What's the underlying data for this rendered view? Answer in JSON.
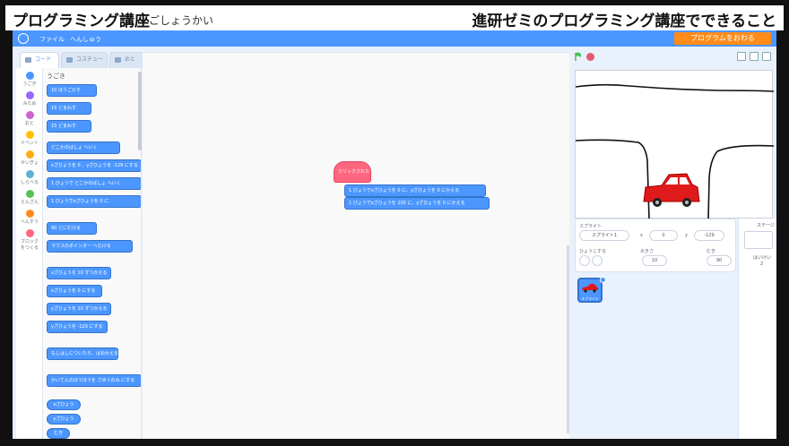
{
  "banner": {
    "left_title": "プログラミング講座",
    "left_subtitle": "ごしょうかい",
    "right_title": "進研ゼミのプログラミング講座でできること"
  },
  "menubar": {
    "file": "ファイル",
    "edit": "へんしゅう",
    "action_button": "プログラムをおわる"
  },
  "tabs": {
    "code": "コード",
    "costume": "コスチューム",
    "sound": "おと"
  },
  "categories": [
    {
      "label": "うごき",
      "color": "#4c97ff"
    },
    {
      "label": "みため",
      "color": "#9966ff"
    },
    {
      "label": "おと",
      "color": "#cf63cf"
    },
    {
      "label": "イベント",
      "color": "#ffbf00"
    },
    {
      "label": "せいぎょ",
      "color": "#ffab19"
    },
    {
      "label": "しらべる",
      "color": "#5cb1d6"
    },
    {
      "label": "えんざん",
      "color": "#59c059"
    },
    {
      "label": "へんすう",
      "color": "#ff8c1a"
    },
    {
      "label": "ブロック\nをつくる",
      "color": "#ff6680"
    }
  ],
  "flyout": {
    "title": "うごき",
    "blocks": [
      "10 ほうごかす",
      "15 どまわす",
      "15 どまわす",
      "どこかのばしょ へいく",
      "xざひょうを 0 、yざひょうを -129 にする",
      "1 びょうで どこかのばしょ へいく",
      "1 びょうでxざひょうを 0 に",
      "90 どにむける",
      "マウスのポインター へむける",
      "xざひょうを 10 ずつかえる",
      "xざひょうを 0 にする",
      "yざひょうを 10 ずつかえる",
      "yざひょうを -129 にする",
      "もしはしについたら、はねかえる",
      "かいてんのほうほうを さゆうのみ にする"
    ],
    "reporters": [
      "xざひょう",
      "yざひょう",
      "むき"
    ]
  },
  "workspace": {
    "hat": "クリックされたとき",
    "block1": "1 びょうでxざひょうを 0 に、yざひょうを 0 にかえる",
    "block2": "1 びょうでxざひょうを 200 に、yざひょうを 0 にかえる"
  },
  "sprite_info": {
    "sprite_label": "スプライト",
    "sprite_name": "スプライト1",
    "x_label": "x",
    "x_value": "0",
    "y_label": "y",
    "y_value": "-129",
    "show_label": "ひょうじする",
    "size_label": "大きさ",
    "size_value": "10",
    "direction_label": "むき",
    "direction_value": "90"
  },
  "sprite_list": {
    "thumb_label": "スプライト"
  },
  "stage_panel": {
    "title": "ステージ",
    "backdrops_label": "はいけい",
    "backdrops_count": "2"
  },
  "colors": {
    "brand_blue": "#4c97ff",
    "orange": "#ff8c1a",
    "hat_pink": "#ff6680",
    "car_red": "#e01a1a"
  }
}
